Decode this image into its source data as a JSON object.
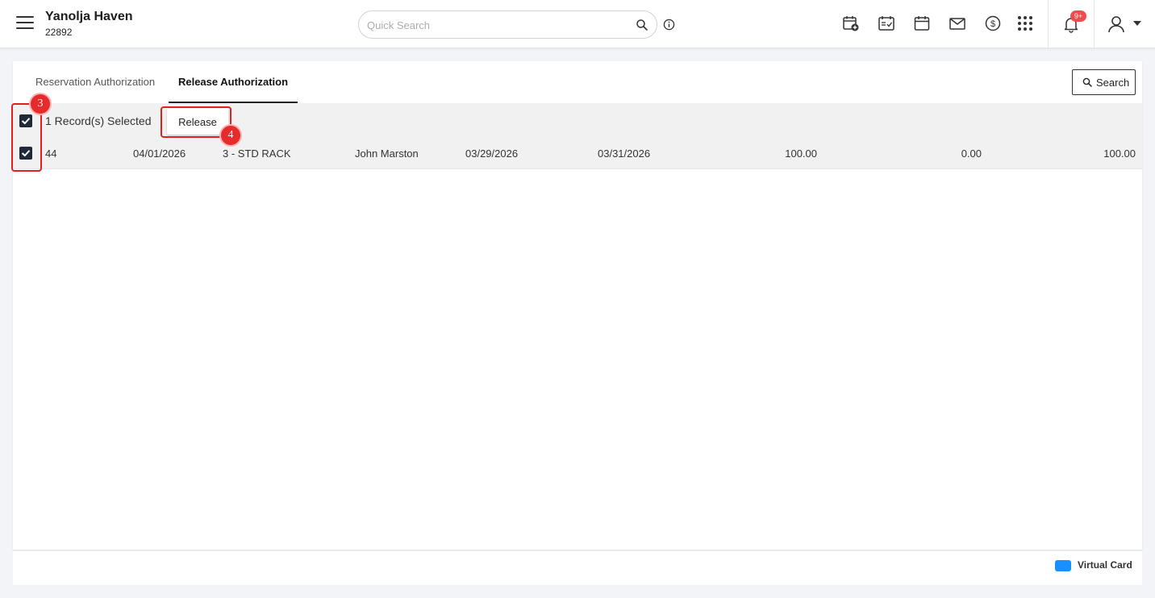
{
  "header": {
    "hotel_name": "Yanolja Haven",
    "hotel_id": "22892",
    "search_placeholder": "Quick Search",
    "notification_count": "9+"
  },
  "tabs": [
    {
      "label": "Reservation Authorization",
      "active": false
    },
    {
      "label": "Release Authorization",
      "active": true
    }
  ],
  "toolbar": {
    "search_label": "Search"
  },
  "selection": {
    "summary": "1 Record(s) Selected",
    "release_label": "Release"
  },
  "rows": [
    {
      "id": "44",
      "date": "04/01/2026",
      "rate": "3 - STD RACK",
      "guest": "John Marston",
      "arrival": "03/29/2026",
      "departure": "03/31/2026",
      "amount1": "100.00",
      "amount2": "0.00",
      "amount3": "100.00",
      "checked": true
    }
  ],
  "annotations": {
    "step_checkbox": "3",
    "step_release": "4"
  },
  "legend": {
    "label": "Virtual Card",
    "color": "#1890ff"
  },
  "colors": {
    "accent": "#1e2a3a",
    "highlight": "#e02020",
    "badge": "#ef4d4d"
  }
}
